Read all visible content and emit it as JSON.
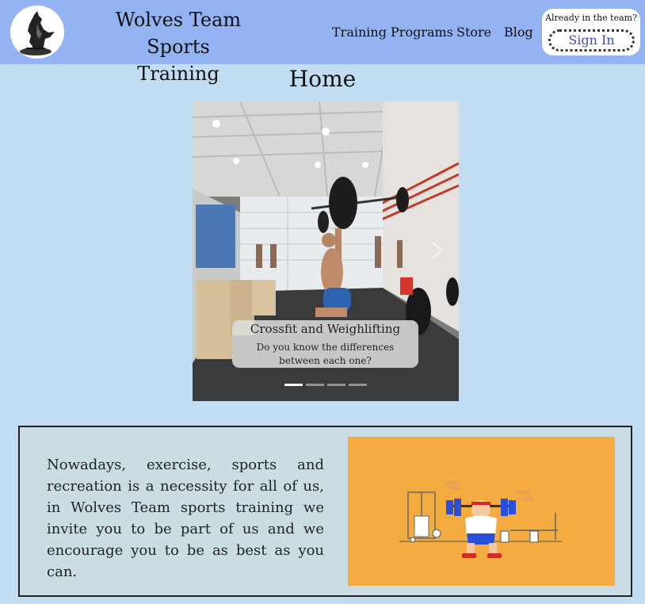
{
  "header": {
    "logo_icon": "wolf-logo-icon",
    "brand_line1": "Wolves Team",
    "brand_line2": "Sports Training",
    "nav": [
      {
        "label": "Training Programs"
      },
      {
        "label": "Store"
      },
      {
        "label": "Blog"
      }
    ],
    "signin_hint": "Already in the team?",
    "signin_label": "Sign In"
  },
  "page": {
    "title": "Home"
  },
  "carousel": {
    "image_icon": "gym-weightlifting-photo",
    "next_icon": "chevron-right-icon",
    "caption_title": "Crossfit and Weighlifting",
    "caption_text": "Do you know the differences between each one?",
    "slide_count": 4,
    "active_index": 0
  },
  "info": {
    "text": "Nowadays, exercise, sports and recreation is a necessity for all of us, in Wolves Team sports training we invite you to be part of us and we encourage you to be as best as you can.",
    "image_icon": "weightlifter-illustration",
    "image_bg": "#f4ab3f"
  },
  "colors": {
    "page_bg": "#c2dcf2",
    "header_bg": "#94b3f3",
    "signin_text": "#3a4fc0",
    "info_bg": "#c9dde2"
  }
}
